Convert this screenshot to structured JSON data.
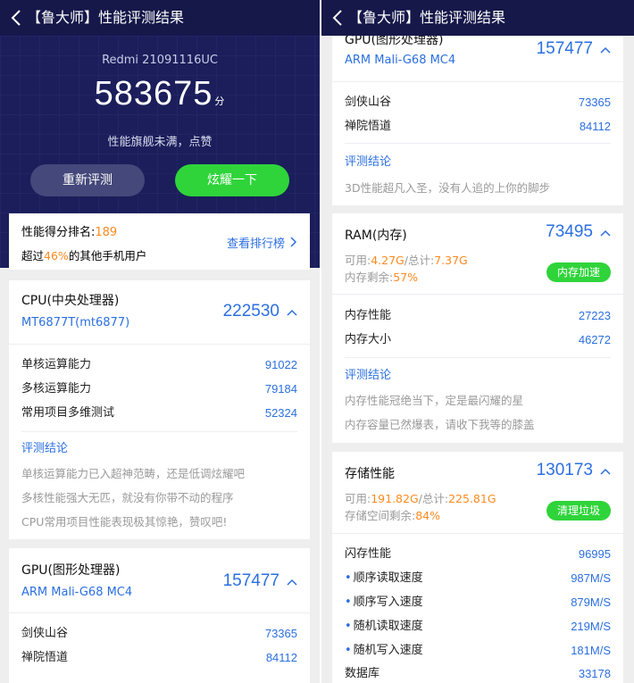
{
  "app": {
    "title": "【鲁大师】性能评测结果"
  },
  "hero": {
    "device": "Redmi 21091116UC",
    "score": "583675",
    "score_unit": "分",
    "tagline": "性能旗舰未满，点赞",
    "retest_label": "重新评测",
    "share_label": "炫耀一下"
  },
  "rank": {
    "label": "性能得分排名:",
    "value": "189",
    "beat_prefix": "超过",
    "beat_pct": "46%",
    "beat_suffix": "的其他手机用户",
    "view_label": "查看排行榜"
  },
  "cpu": {
    "title": "CPU(中央处理器)",
    "model": "MT6877T(mt6877)",
    "score": "222530",
    "items": [
      {
        "label": "单核运算能力",
        "value": "91022"
      },
      {
        "label": "多核运算能力",
        "value": "79184"
      },
      {
        "label": "常用项目多维测试",
        "value": "52324"
      }
    ],
    "conclusion_title": "评测结论",
    "conclusions": [
      "单核运算能力已入超神范畴，还是低调炫耀吧",
      "多核性能强大无匹，就没有你带不动的程序",
      "CPU常用项目性能表现极其惊艳，赞叹吧!"
    ]
  },
  "gpu": {
    "title": "GPU(图形处理器)",
    "model": "ARM Mali-G68 MC4",
    "score": "157477",
    "items": [
      {
        "label": "剑侠山谷",
        "value": "73365"
      },
      {
        "label": "禅院悟道",
        "value": "84112"
      }
    ],
    "conclusion_title": "评测结论",
    "conclusion": "3D性能超凡入圣，没有人追的上你的脚步"
  },
  "ram": {
    "title": "RAM(内存)",
    "score": "73495",
    "avail_label": "可用:",
    "avail_value": "4.27G",
    "total_label": "/总计:",
    "total_value": "7.37G",
    "remain_label": "内存剩余:",
    "remain_value": "57%",
    "boost_label": "内存加速",
    "items": [
      {
        "label": "内存性能",
        "value": "27223"
      },
      {
        "label": "内存大小",
        "value": "46272"
      }
    ],
    "conclusion_title": "评测结论",
    "conclusions": [
      "内存性能冠绝当下，定是最闪耀的星",
      "内存容量已然爆表，请收下我等的膝盖"
    ]
  },
  "storage": {
    "title": "存储性能",
    "score": "130173",
    "avail_label": "可用:",
    "avail_value": "191.82G",
    "total_label": "/总计:",
    "total_value": "225.81G",
    "remain_label": "存储空间剩余:",
    "remain_value": "84%",
    "clean_label": "清理垃圾",
    "flash_label": "闪存性能",
    "flash_value": "96995",
    "items": [
      {
        "label": "顺序读取速度",
        "value": "987M/S"
      },
      {
        "label": "顺序写入速度",
        "value": "879M/S"
      },
      {
        "label": "随机读取速度",
        "value": "219M/S"
      },
      {
        "label": "随机写入速度",
        "value": "181M/S"
      }
    ],
    "db_label": "数据库",
    "db_value": "33178"
  },
  "colors": {
    "accent": "#2b6fe0",
    "green": "#2fd43a",
    "orange": "#ff8a1e",
    "header": "#16184a"
  }
}
